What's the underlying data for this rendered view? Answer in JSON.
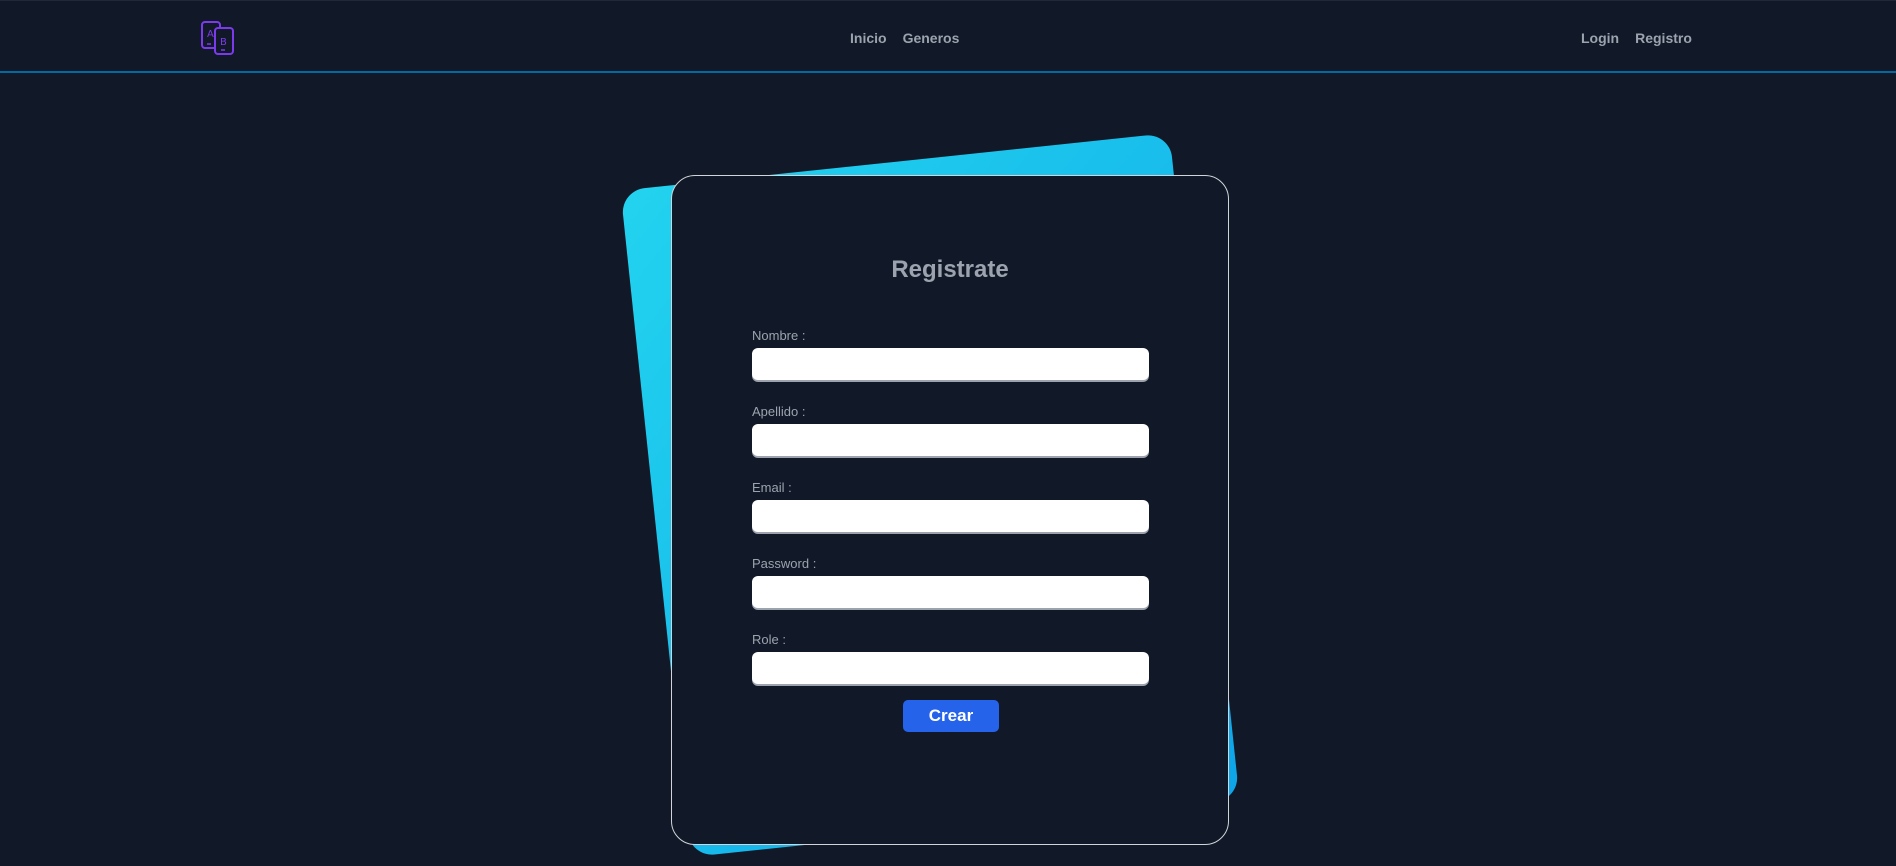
{
  "nav": {
    "logo_icon": "translate-icon",
    "center_links": [
      {
        "label": "Inicio"
      },
      {
        "label": "Generos"
      }
    ],
    "right_links": [
      {
        "label": "Login"
      },
      {
        "label": "Registro"
      }
    ]
  },
  "form": {
    "title": "Registrate",
    "fields": [
      {
        "label": "Nombre :",
        "value": "",
        "placeholder": ""
      },
      {
        "label": "Apellido :",
        "value": "",
        "placeholder": ""
      },
      {
        "label": "Email :",
        "value": "",
        "placeholder": ""
      },
      {
        "label": "Password :",
        "value": "",
        "placeholder": ""
      },
      {
        "label": "Role :",
        "value": "",
        "placeholder": ""
      }
    ],
    "submit_label": "Crear"
  },
  "colors": {
    "background": "#111827",
    "accent_gradient_start": "#22d3ee",
    "accent_gradient_end": "#0ea5e9",
    "button": "#2563eb",
    "logo": "#7c3aed",
    "nav_border": "#0369a1"
  }
}
